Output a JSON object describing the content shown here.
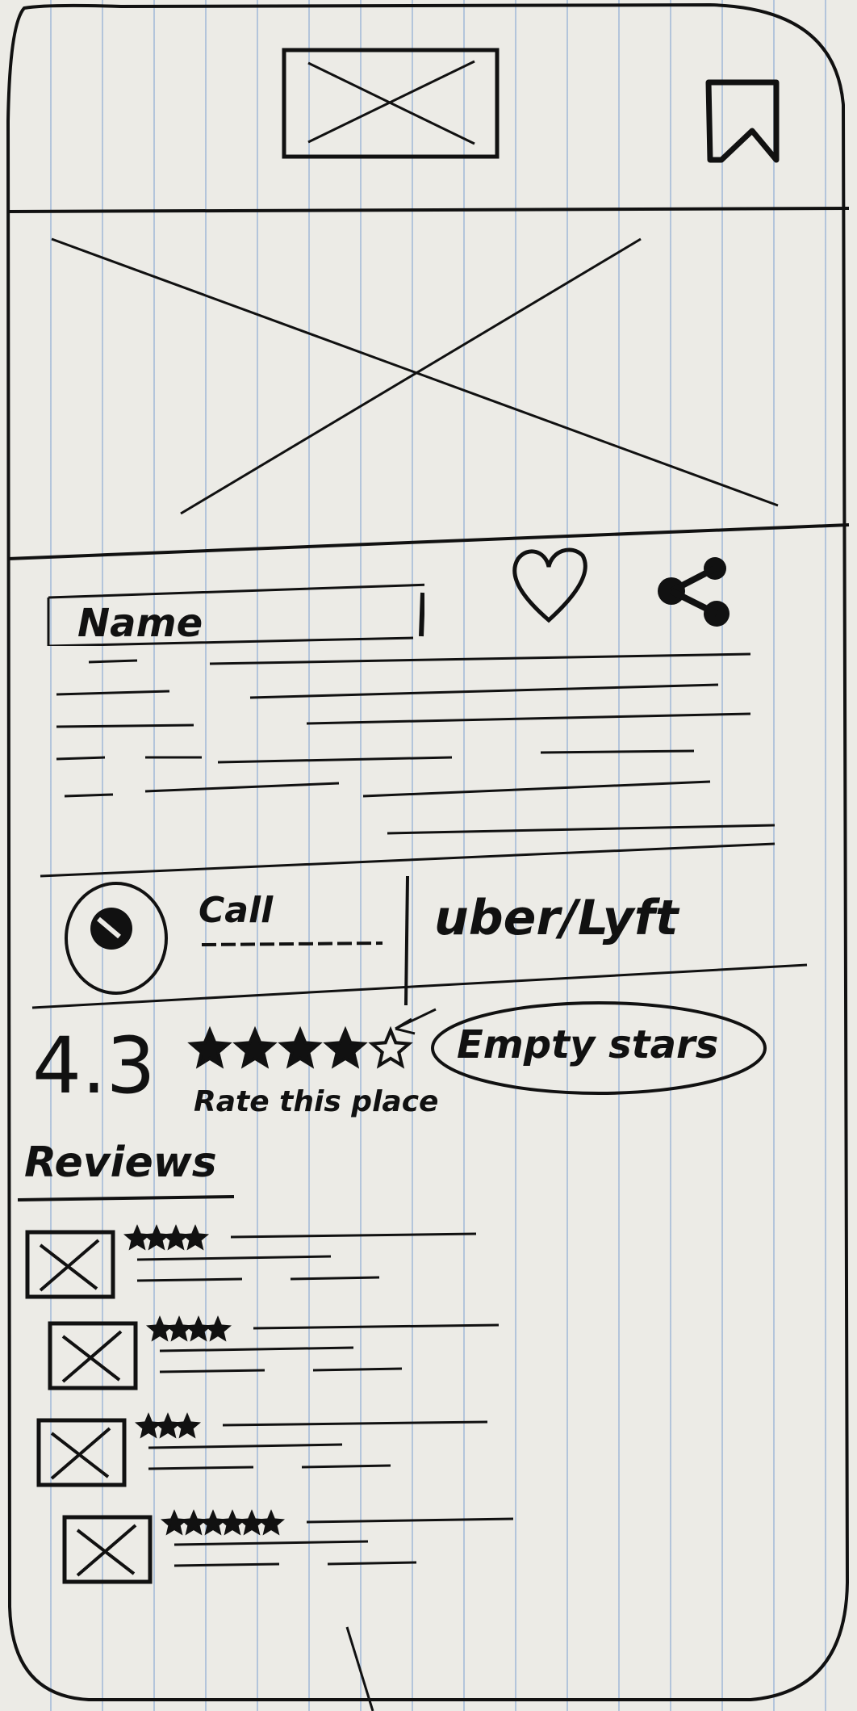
{
  "colors": {
    "paper": "#ecebe6",
    "ink": "#111111",
    "rule": "#6e96cd"
  },
  "header": {
    "logo_icon": "image-placeholder-icon",
    "bookmark_icon": "bookmark-icon"
  },
  "hero": {
    "icon": "image-placeholder-icon"
  },
  "place": {
    "name": "Name",
    "favorite_icon": "heart-icon",
    "share_icon": "share-icon"
  },
  "actions": {
    "call_icon": "phone-icon",
    "call_label": "Call",
    "ride_label": "uber/Lyft"
  },
  "rating": {
    "value": "4.3",
    "stars_total": 5,
    "stars_filled": 4,
    "rate_label": "Rate this place",
    "annotation": "Empty stars"
  },
  "reviews": {
    "title": "Reviews",
    "items": [
      {
        "stars": 4,
        "avatar_icon": "image-placeholder-icon"
      },
      {
        "stars": 4,
        "avatar_icon": "image-placeholder-icon"
      },
      {
        "stars": 3,
        "avatar_icon": "image-placeholder-icon"
      },
      {
        "stars": 6,
        "avatar_icon": "image-placeholder-icon"
      }
    ]
  }
}
